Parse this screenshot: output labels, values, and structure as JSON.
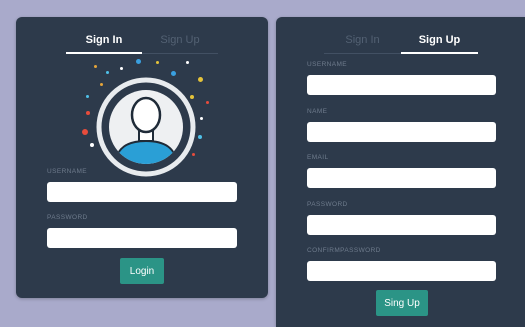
{
  "signin": {
    "tabs": [
      {
        "label": "Sign In",
        "active": true
      },
      {
        "label": "Sign Up",
        "active": false
      }
    ],
    "avatar_icon": "user-avatar-icon",
    "fields": [
      {
        "label": "USERNAME",
        "value": "",
        "placeholder": ""
      },
      {
        "label": "PASSWORD",
        "value": "",
        "placeholder": ""
      }
    ],
    "button_label": "Login"
  },
  "signup": {
    "tabs": [
      {
        "label": "Sign In",
        "active": false
      },
      {
        "label": "Sign Up",
        "active": true
      }
    ],
    "fields": [
      {
        "label": "USERNAME",
        "value": "",
        "placeholder": ""
      },
      {
        "label": "NAME",
        "value": "",
        "placeholder": ""
      },
      {
        "label": "EMAIL",
        "value": "",
        "placeholder": ""
      },
      {
        "label": "PASSWORD",
        "value": "",
        "placeholder": ""
      },
      {
        "label": "CONFIRMPASSWORD",
        "value": "",
        "placeholder": ""
      }
    ],
    "button_label": "Sing Up"
  },
  "colors": {
    "page_background": "#a9aacb",
    "card_background": "#2d3a4b",
    "button_accent": "#2b9486",
    "avatar_blue": "#2a9fd6"
  }
}
